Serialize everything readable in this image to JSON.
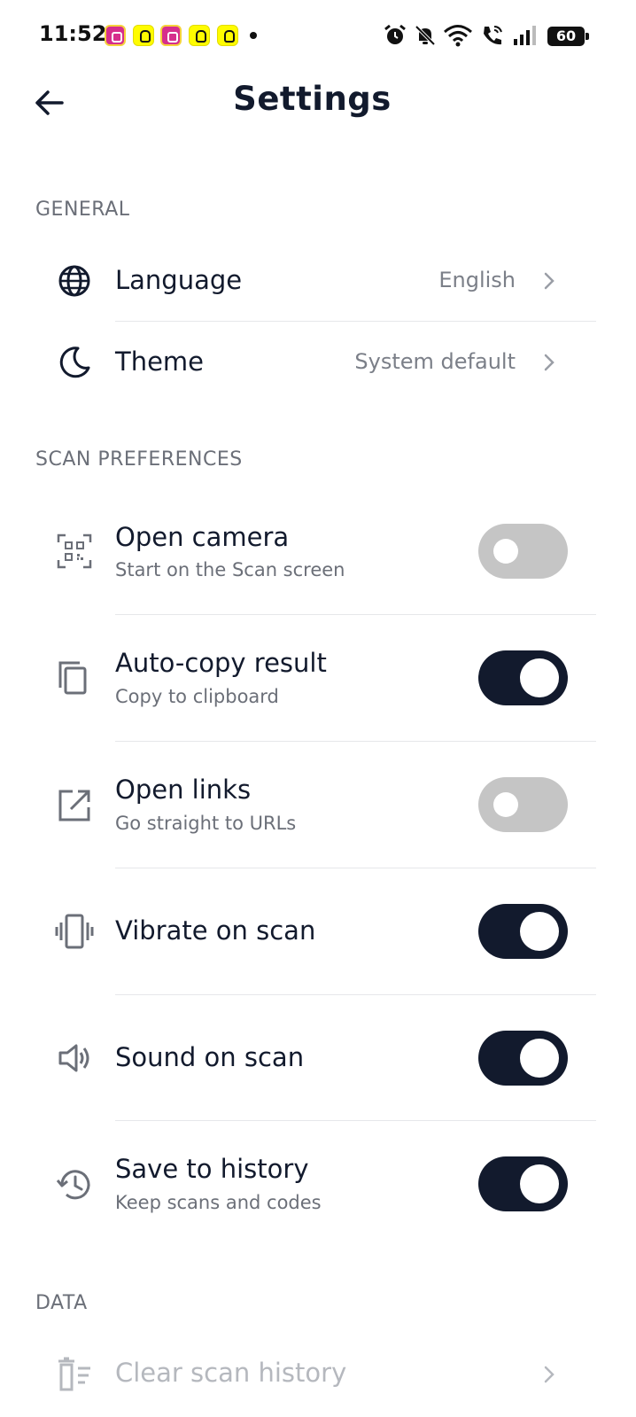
{
  "status_bar": {
    "time": "11:52",
    "battery": "60",
    "notifications": [
      "instagram-icon",
      "snapchat-icon",
      "instagram-icon",
      "snapchat-icon",
      "snapchat-icon"
    ],
    "system_icons": [
      "alarm-icon",
      "bell-muted-icon",
      "wifi-icon",
      "wifi-calling-icon",
      "signal-icon",
      "battery-icon"
    ]
  },
  "header": {
    "title": "Settings",
    "back_icon": "arrow-left-icon"
  },
  "sections": {
    "general": {
      "label": "GENERAL",
      "items": [
        {
          "title": "Language",
          "value": "English",
          "icon": "globe-icon"
        },
        {
          "title": "Theme",
          "value": "System default",
          "icon": "moon-icon"
        }
      ]
    },
    "scan_preferences": {
      "label": "SCAN PREFERENCES",
      "items": [
        {
          "title": "Open camera",
          "subtitle": "Start on the Scan screen",
          "icon": "qr-scan-icon",
          "enabled": false
        },
        {
          "title": "Auto-copy result",
          "subtitle": "Copy to clipboard",
          "icon": "copy-icon",
          "enabled": true
        },
        {
          "title": "Open links",
          "subtitle": "Go straight to URLs",
          "icon": "open-external-icon",
          "enabled": false
        },
        {
          "title": "Vibrate on scan",
          "subtitle": "",
          "icon": "vibrate-icon",
          "enabled": true
        },
        {
          "title": "Sound on scan",
          "subtitle": "",
          "icon": "speaker-icon",
          "enabled": true
        },
        {
          "title": "Save to history",
          "subtitle": "Keep scans and codes",
          "icon": "history-icon",
          "enabled": true
        }
      ]
    },
    "data": {
      "label": "DATA",
      "items": [
        {
          "title": "Clear scan history",
          "icon": "delete-list-icon",
          "disabled": true
        }
      ]
    }
  },
  "colors": {
    "text_primary": "#121a2d",
    "text_secondary": "#6b6f78",
    "toggle_on": "#121a2d",
    "toggle_off": "#c5c5c5",
    "divider": "#e6e7ea"
  }
}
